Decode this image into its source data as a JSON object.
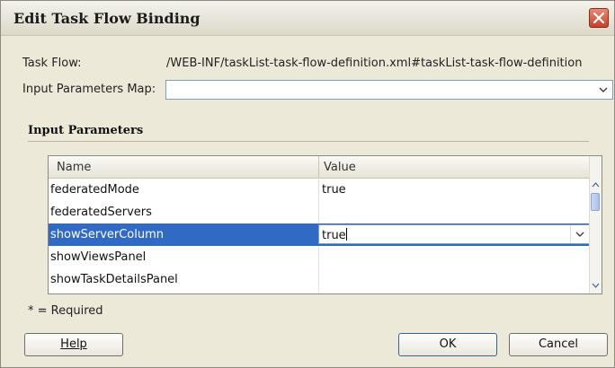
{
  "dialog": {
    "title": "Edit Task Flow Binding",
    "close_icon": "close-icon"
  },
  "fields": {
    "task_flow_label": "Task Flow:",
    "task_flow_value": "/WEB-INF/taskList-task-flow-definition.xml#taskList-task-flow-definition",
    "input_params_map_label": "Input Parameters Map:",
    "input_params_map_value": ""
  },
  "section": {
    "title": "Input Parameters"
  },
  "table": {
    "columns": [
      "Name",
      "Value"
    ],
    "rows": [
      {
        "name": "federatedMode",
        "value": "true"
      },
      {
        "name": "federatedServers",
        "value": ""
      },
      {
        "name": "showServerColumn",
        "value": "true",
        "selected": true
      },
      {
        "name": "showViewsPanel",
        "value": ""
      },
      {
        "name": "showTaskDetailsPanel",
        "value": ""
      }
    ]
  },
  "footer": {
    "required_note": "* = Required"
  },
  "buttons": {
    "help": "Help",
    "ok": "OK",
    "cancel": "Cancel"
  },
  "colors": {
    "selection": "#316ac5",
    "close_button": "#c7432a"
  }
}
